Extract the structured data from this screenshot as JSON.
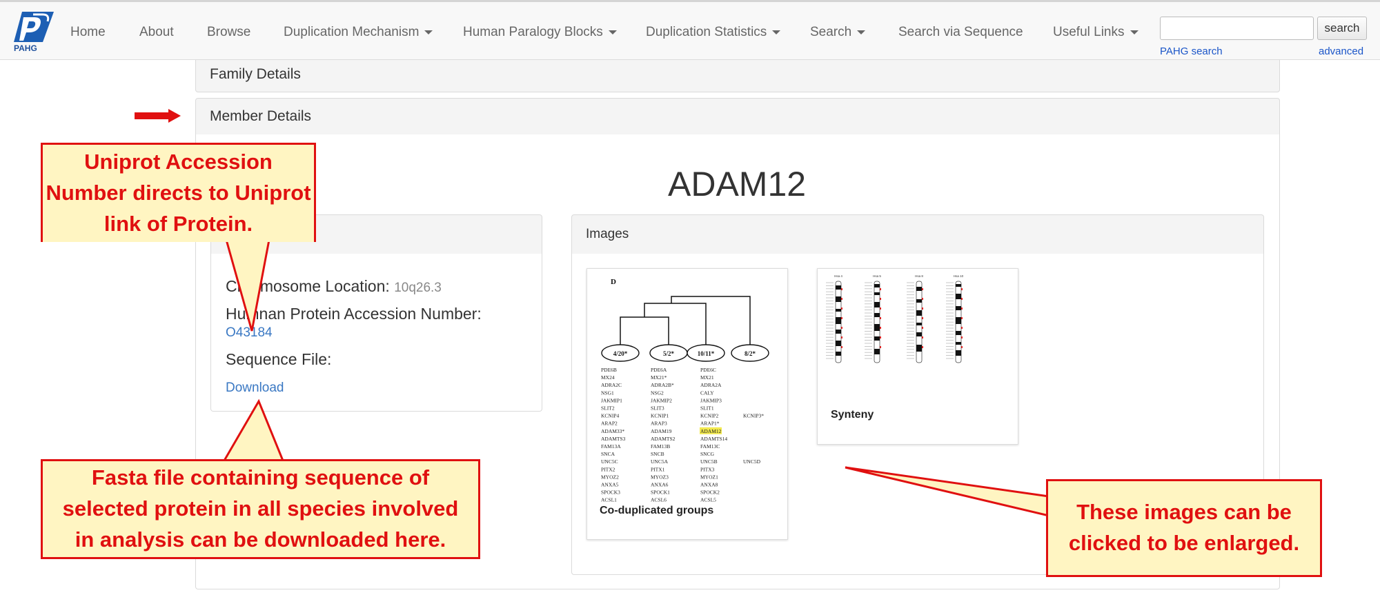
{
  "nav": {
    "logo_text": "PAHG",
    "items": [
      {
        "label": "Home",
        "dropdown": false
      },
      {
        "label": "About",
        "dropdown": false
      },
      {
        "label": "Browse",
        "dropdown": false
      },
      {
        "label": "Duplication Mechanism",
        "dropdown": true
      },
      {
        "label": "Human Paralogy Blocks",
        "dropdown": true
      },
      {
        "label": "Duplication Statistics",
        "dropdown": true
      },
      {
        "label": "Search",
        "dropdown": true
      },
      {
        "label": "Search via Sequence",
        "dropdown": false
      },
      {
        "label": "Useful Links",
        "dropdown": true
      }
    ],
    "search": {
      "placeholder": "",
      "button_label": "search",
      "pahg_search_label": "PAHG search",
      "advanced_label": "advanced"
    }
  },
  "sections": {
    "family_details": "Family Details",
    "member_details": "Member Details"
  },
  "member": {
    "gene_name": "ADAM12",
    "chromosome_label": "Chromosome Location:",
    "chromosome_value": "10q26.3",
    "accession_label": "Humnan Protein Accession Number:",
    "accession_value": "O43184",
    "sequence_label": "Sequence File:",
    "download_label": "Download"
  },
  "images": {
    "panel_title": "Images",
    "items": [
      {
        "caption": "Co-duplicated groups",
        "figure_letter": "D"
      },
      {
        "caption": "Synteny",
        "chromosome_labels": [
          "Hsa 4",
          "Hsa 5",
          "Hsa 8",
          "Hsa 10"
        ]
      }
    ],
    "tree_nodes": [
      "4/20*",
      "5/2*",
      "10/11*",
      "8/2*"
    ],
    "gene_columns": [
      [
        "PDE6B",
        "MX24",
        "ADRA2C",
        "NSG1",
        "JAKMIP1",
        "SLIT2",
        "KCNIP4",
        "ARAP2",
        "ADAM33*",
        "ADAMTS3",
        "FAM13A",
        "SNCA",
        "UNC5C",
        "PITX2",
        "MYOZ2",
        "ANXA5",
        "SPOCK3",
        "ACSL1"
      ],
      [
        "PDE6A",
        "MX21*",
        "ADRA2B*",
        "NSG2",
        "JAKMIP2",
        "SLIT3",
        "KCNIP1",
        "ARAP3",
        "ADAM19",
        "ADAMTS2",
        "FAM13B",
        "SNCB",
        "UNC5A",
        "PITX1",
        "MYOZ3",
        "ANXA6",
        "SPOCK1",
        "ACSL6"
      ],
      [
        "PDE6C",
        "MX21",
        "ADRA2A",
        "CALY",
        "JAKMIP3",
        "SLIT1",
        "KCNIP2",
        "ARAP1*",
        "ADAM12",
        "ADAMTS14",
        "FAM13C",
        "SNCG",
        "UNC5B",
        "PITX3",
        "MYOZ1",
        "ANXA8",
        "SPOCK2",
        "ACSL5"
      ],
      [
        "",
        "",
        "",
        "",
        "",
        "",
        "KCNIP3*",
        "",
        "",
        "",
        "",
        "",
        "UNC5D",
        "",
        "",
        "",
        "",
        ""
      ]
    ]
  },
  "annotations": {
    "accession_note": "Uniprot Accession Number directs to Uniprot link of Protein.",
    "download_note": "Fasta file containing sequence of selected protein in all species involved in analysis can be downloaded here.",
    "images_note": "These images can be clicked to be enlarged."
  },
  "colors": {
    "annotation_red": "#e01010",
    "annotation_fill": "#fff5c2",
    "link_blue": "#3a78c3",
    "highlight_yellow": "#f2e94e"
  }
}
